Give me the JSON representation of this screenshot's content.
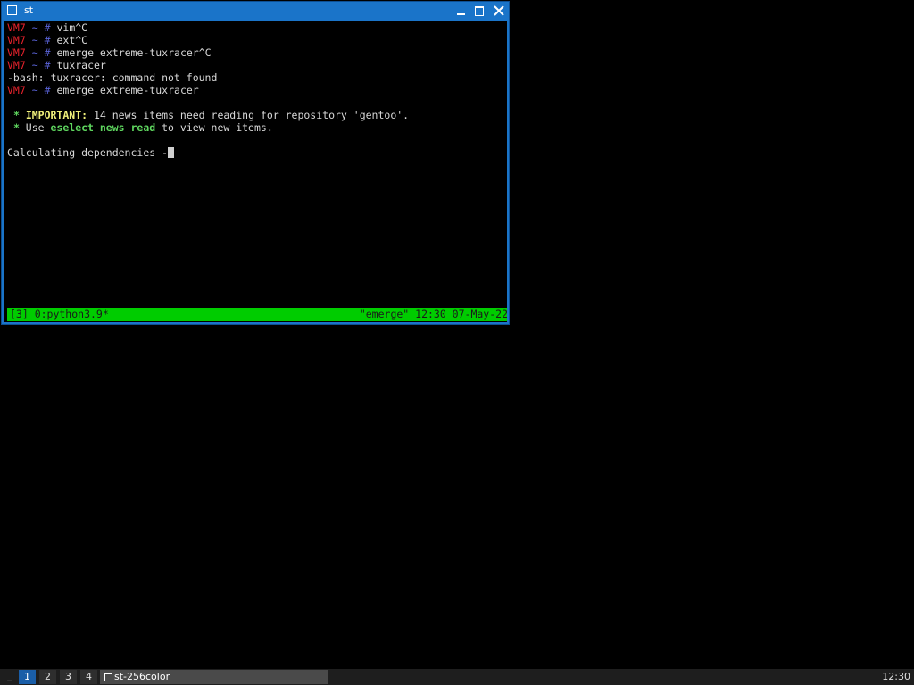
{
  "window": {
    "title": "st"
  },
  "terminal": {
    "host": "VM7",
    "tilde": "~",
    "hash": "#",
    "commands": [
      "vim^C",
      "ext^C",
      "emerge extreme-tuxracer^C",
      "tuxracer"
    ],
    "error_line": "-bash: tuxracer: command not found",
    "last_command": "emerge extreme-tuxracer",
    "news": {
      "star": "*",
      "important_label": "IMPORTANT:",
      "important_text": " 14 news items need reading for repository 'gentoo'.",
      "use_prefix": " Use ",
      "use_cmd": "eselect news read",
      "use_suffix": " to view new items."
    },
    "calculating": "Calculating dependencies -"
  },
  "tmux": {
    "left": "[3] 0:python3.9*",
    "right": "\"emerge\" 12:30 07-May-22"
  },
  "taskbar": {
    "menu_glyph": "_",
    "workspaces": [
      "1",
      "2",
      "3",
      "4"
    ],
    "active_workspace": "1",
    "task_label": "st-256color",
    "clock": "12:30"
  },
  "colors": {
    "window_border": "#1a74c9",
    "tmux_bar": "#00cc00",
    "prompt_host": "#e8222c",
    "prompt_symbol": "#5a63d8"
  }
}
